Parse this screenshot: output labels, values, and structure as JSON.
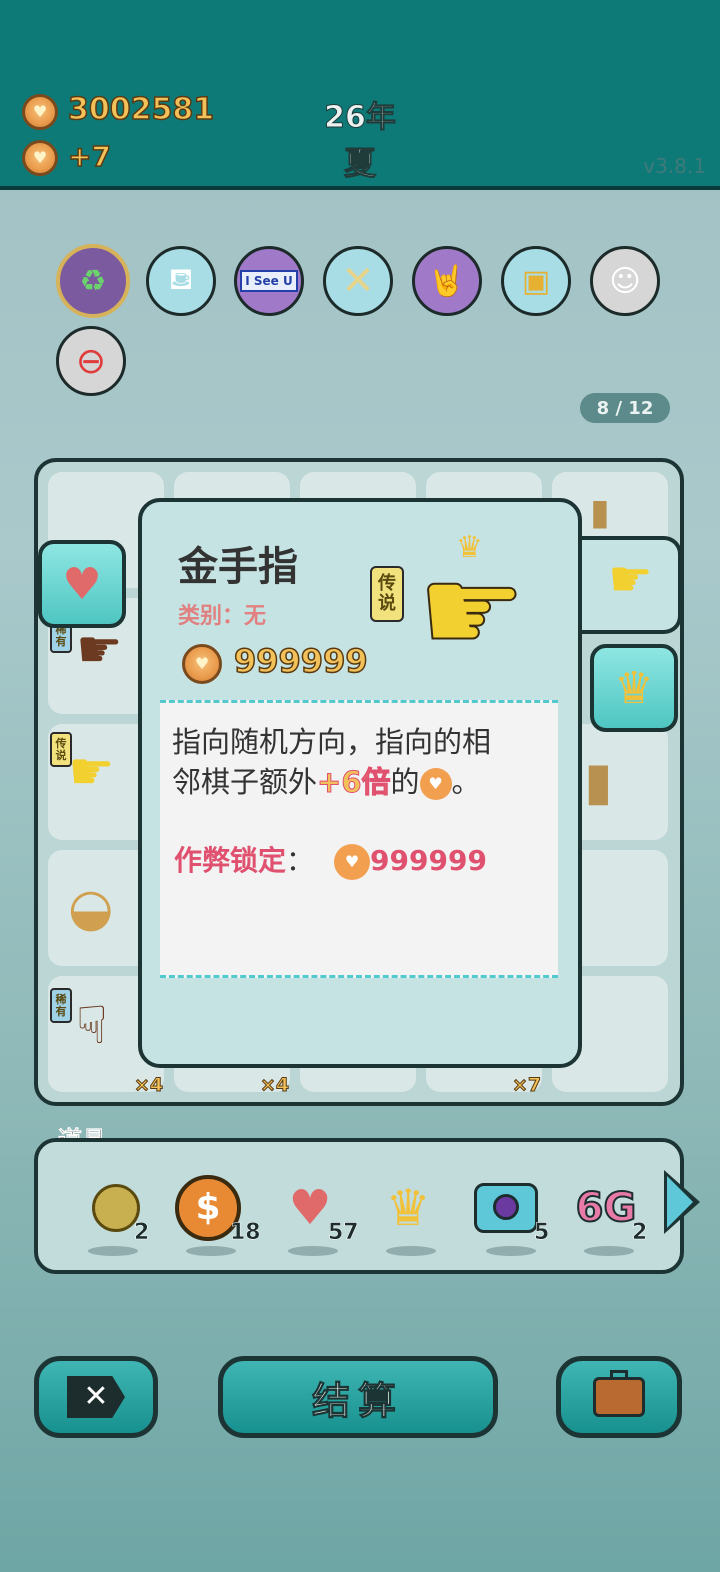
{
  "header": {
    "coins_total": "3002581",
    "coins_per_turn": "+7",
    "year": "26年",
    "season": "夏",
    "version": "v3.8.1",
    "coin_glyph": "♥"
  },
  "skills": [
    {
      "icon": "recycle-icon",
      "glyph": "♻"
    },
    {
      "icon": "gravy-boat-icon",
      "glyph": "🫖"
    },
    {
      "icon": "i-see-u-icon",
      "glyph": "I See U"
    },
    {
      "icon": "chopsticks-icon",
      "glyph": "✕"
    },
    {
      "icon": "rock-hand-icon",
      "glyph": "🤘"
    },
    {
      "icon": "traffic-light-ghost-icon",
      "glyph": "🚦"
    },
    {
      "icon": "ghost-icon",
      "glyph": "👻"
    },
    {
      "icon": "minus-circle-icon",
      "glyph": "⊖"
    }
  ],
  "page_counter": "8 / 12",
  "board": {
    "tag_rare": "稀有",
    "tag_legend": "传说",
    "count_x4_a": "×4",
    "count_x4_b": "×4",
    "count_x7": "×7"
  },
  "popup": {
    "title": "金手指",
    "category": "类别：无",
    "rarity": "传说",
    "price": "999999",
    "description_line1": "指向随机方向，指向的相",
    "description_line2_pre": "邻棋子额外",
    "description_highlight": "+6倍",
    "description_line2_post": "的",
    "description_end": "。",
    "lock_label": "作弊锁定",
    "lock_colon": "：",
    "lock_value": "999999"
  },
  "items_panel": {
    "title": "道具",
    "items": [
      {
        "icon": "gold-ball-icon",
        "count": "2"
      },
      {
        "icon": "dollar-coin-icon",
        "count": "18"
      },
      {
        "icon": "liver-icon",
        "count": "57"
      },
      {
        "icon": "crown-icon",
        "count": ""
      },
      {
        "icon": "camera-icon",
        "count": "5"
      },
      {
        "icon": "6g-icon",
        "label": "6G",
        "count": "2"
      }
    ]
  },
  "buttons": {
    "settle": "结算"
  },
  "colors": {
    "topbar": "#0e7a78",
    "gold": "#f2c15a",
    "teal_button": "#17918f",
    "pink_text": "#e0506f"
  }
}
